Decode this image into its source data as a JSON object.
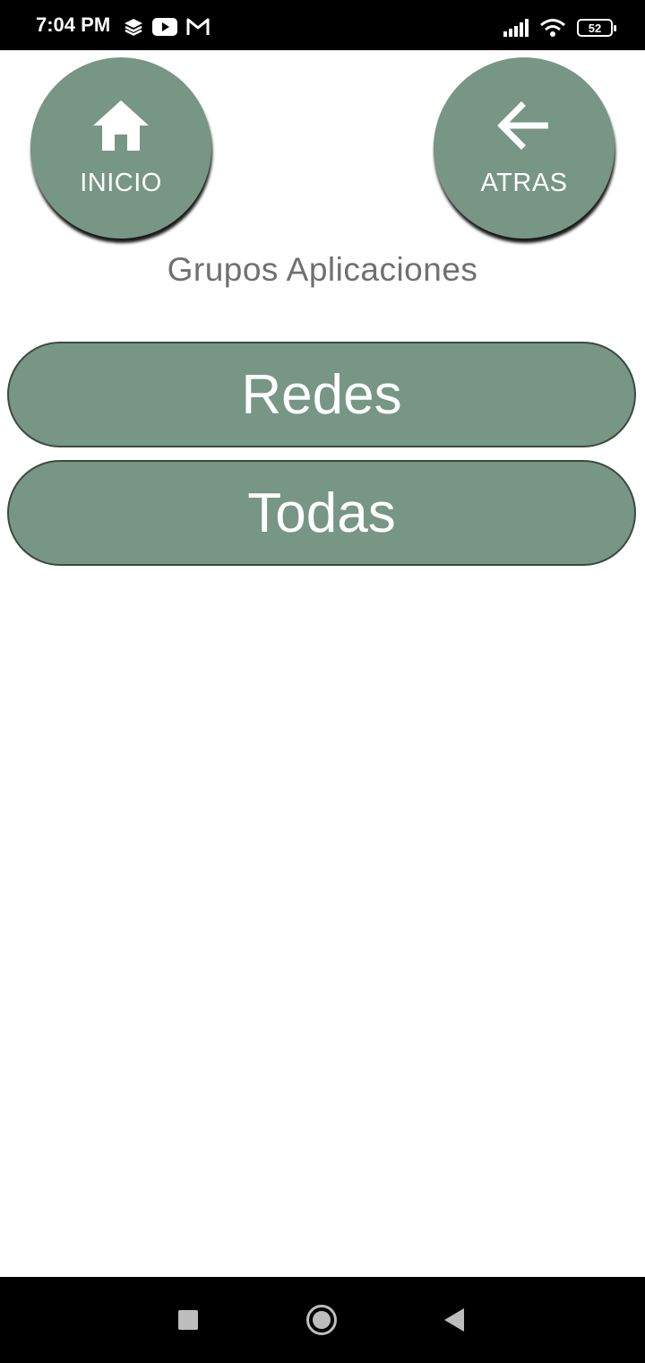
{
  "status_bar": {
    "time": "7:04 PM",
    "left_icons": [
      "layers-icon",
      "youtube-icon",
      "gmail-icon"
    ],
    "right_icons": [
      "signal-icon",
      "wifi-icon",
      "battery-icon"
    ],
    "battery_level": "52"
  },
  "header": {
    "home_button": {
      "label": "INICIO",
      "icon": "home-icon"
    },
    "back_button": {
      "label": "ATRAS",
      "icon": "arrow-left-icon"
    }
  },
  "section_title": "Grupos Aplicaciones",
  "groups": [
    {
      "label": "Redes"
    },
    {
      "label": "Todas"
    }
  ],
  "nav_bar": {
    "buttons": [
      "recent-apps-icon",
      "home-circle-icon",
      "back-triangle-icon"
    ]
  },
  "colors": {
    "button_fill": "#779685",
    "button_border": "#3b4b42",
    "title_text": "#707070",
    "status_bar_bg": "#000000"
  }
}
